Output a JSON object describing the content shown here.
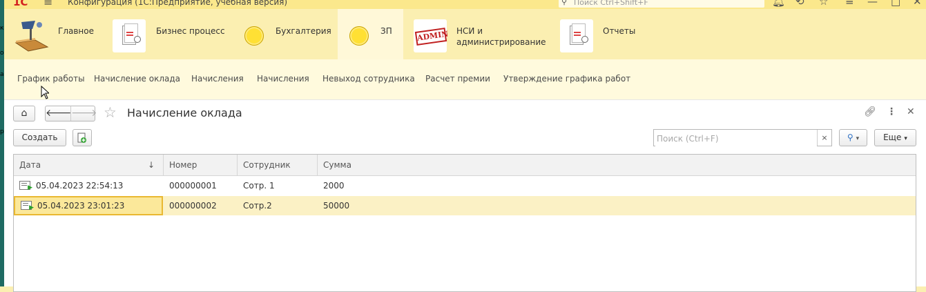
{
  "titlebar": {
    "logo": "1С",
    "title": "Конфигурация  (1С:Предприятие, учебная версия)",
    "search_placeholder": "Поиск Ctrl+Shift+F"
  },
  "sections": [
    {
      "label": "Главное",
      "icon": "lamp-icon"
    },
    {
      "label": "Бизнес процесс",
      "icon": "document-icon"
    },
    {
      "label": "Бухгалтерия",
      "icon": "coin-icon"
    },
    {
      "label": "ЗП",
      "icon": "coin-icon",
      "active": true
    },
    {
      "label": "НСИ и",
      "label2": "администрирование",
      "icon": "admin-stamp-icon"
    },
    {
      "label": "Отчеты",
      "icon": "document-icon"
    }
  ],
  "submenu": [
    "График работы",
    "Начисление оклада",
    "Начисления",
    "Начисления",
    "Невыход сотрудника",
    "Расчет премии",
    "Утверждение графика работ"
  ],
  "form": {
    "title": "Начисление оклада",
    "create_label": "Создать",
    "search_placeholder": "Поиск (Ctrl+F)",
    "search_clear": "×",
    "more_label": "Еще"
  },
  "table": {
    "columns": [
      "Дата",
      "Номер",
      "Сотрудник",
      "Сумма"
    ],
    "sort_indicator": "↓",
    "rows": [
      {
        "date": "05.04.2023 22:54:13",
        "number": "000000001",
        "employee": "Сотр. 1",
        "sum": "2000"
      },
      {
        "date": "05.04.2023 23:01:23",
        "number": "000000002",
        "employee": "Сотр.2",
        "sum": "50000",
        "selected": true
      }
    ]
  },
  "colors": {
    "accent": "#fbefb1",
    "active_section": "#fff8d8",
    "selection": "#fbe89a"
  }
}
